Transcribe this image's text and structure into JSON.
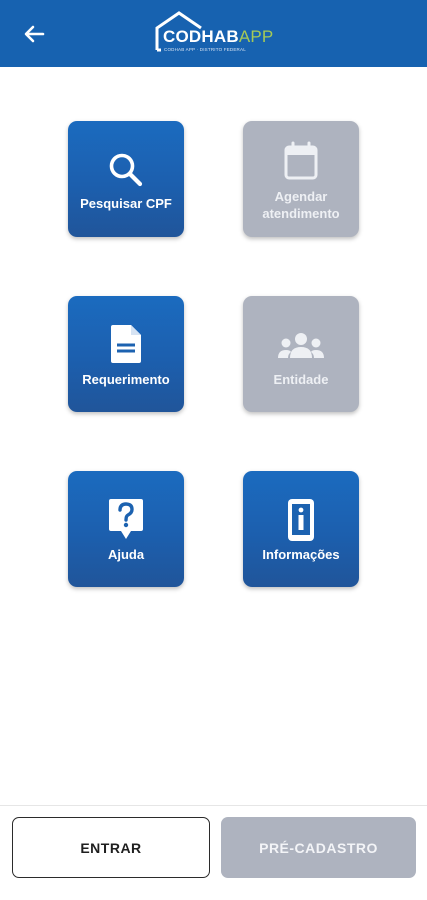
{
  "header": {
    "logo_main": "CODHAB",
    "logo_app": "APP",
    "logo_tagline": "CODHAB APP · DISTRITO FEDERAL"
  },
  "tiles": [
    {
      "label": "Pesquisar CPF",
      "icon": "search-icon",
      "enabled": true
    },
    {
      "label": "Agendar atendimento",
      "icon": "calendar-icon",
      "enabled": false
    },
    {
      "label": "Requerimento",
      "icon": "document-icon",
      "enabled": true
    },
    {
      "label": "Entidade",
      "icon": "group-icon",
      "enabled": false
    },
    {
      "label": "Ajuda",
      "icon": "help-icon",
      "enabled": true
    },
    {
      "label": "Informações",
      "icon": "info-icon",
      "enabled": true
    }
  ],
  "footer": {
    "login_label": "ENTRAR",
    "precadastro_label": "PRÉ-CADASTRO"
  },
  "colors": {
    "primary": "#1762b0",
    "disabled": "#aeb3bf",
    "accent": "#a5c956"
  }
}
